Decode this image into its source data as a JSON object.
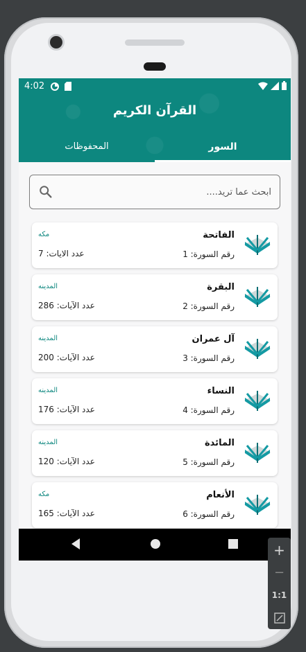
{
  "status_bar": {
    "time": "4:02"
  },
  "app": {
    "title": "القرآن الكريم"
  },
  "tabs": [
    {
      "label": "المحفوظات"
    },
    {
      "label": "السور"
    }
  ],
  "search": {
    "placeholder": "ابحث عما تريد...."
  },
  "surahs": [
    {
      "name": "الفاتحة",
      "number_text": "رقم السورة: 1",
      "place": "مكه",
      "ayat_text": "عدد الايات: 7"
    },
    {
      "name": "البقرة",
      "number_text": "رقم السورة: 2",
      "place": "المدينه",
      "ayat_text": "عدد الآيات: 286"
    },
    {
      "name": "آل عمران",
      "number_text": "رقم السورة: 3",
      "place": "المدينه",
      "ayat_text": "عدد الآيات: 200"
    },
    {
      "name": "النساء",
      "number_text": "رقم السورة: 4",
      "place": "المدينه",
      "ayat_text": "عدد الآيات: 176"
    },
    {
      "name": "المائدة",
      "number_text": "رقم السورة: 5",
      "place": "المدينه",
      "ayat_text": "عدد الآيات: 120"
    },
    {
      "name": "الأنعام",
      "number_text": "رقم السورة: 6",
      "place": "مكه",
      "ayat_text": "عدد الآيات: 165"
    }
  ],
  "emulator_zoom": {
    "zoom_in": "+",
    "zoom_out": "−",
    "actual_size": "1:1"
  },
  "colors": {
    "primary": "#0d877f",
    "book_teal": "#149aa3"
  }
}
